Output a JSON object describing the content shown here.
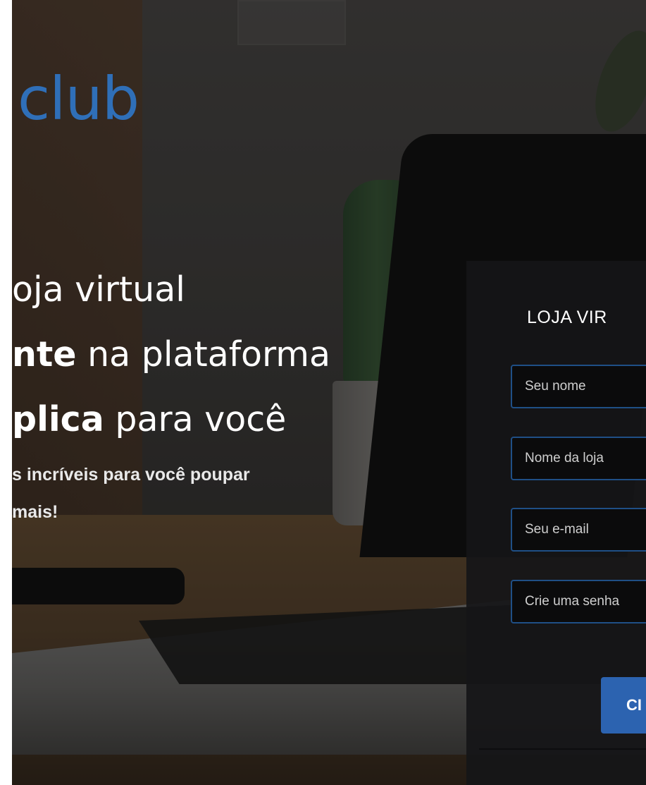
{
  "brand": {
    "logo_text": "club",
    "logo_color": "#2f6fb8"
  },
  "hero": {
    "headline": {
      "line1": "oja virtual",
      "line2_bold": "nte",
      "line2_rest": " na plataforma",
      "line3_bold": "plica",
      "line3_rest": " para você"
    },
    "subtext": {
      "line1": "s incríveis para você poupar",
      "line2": "mais!"
    }
  },
  "signup_form": {
    "title": "LOJA VIR",
    "fields": {
      "name_placeholder": "Seu nome",
      "store_placeholder": "Nome da loja",
      "email_placeholder": "Seu e-mail",
      "password_placeholder": "Crie uma senha"
    },
    "submit_label": "CI",
    "accent_color": "#2c63b0"
  }
}
